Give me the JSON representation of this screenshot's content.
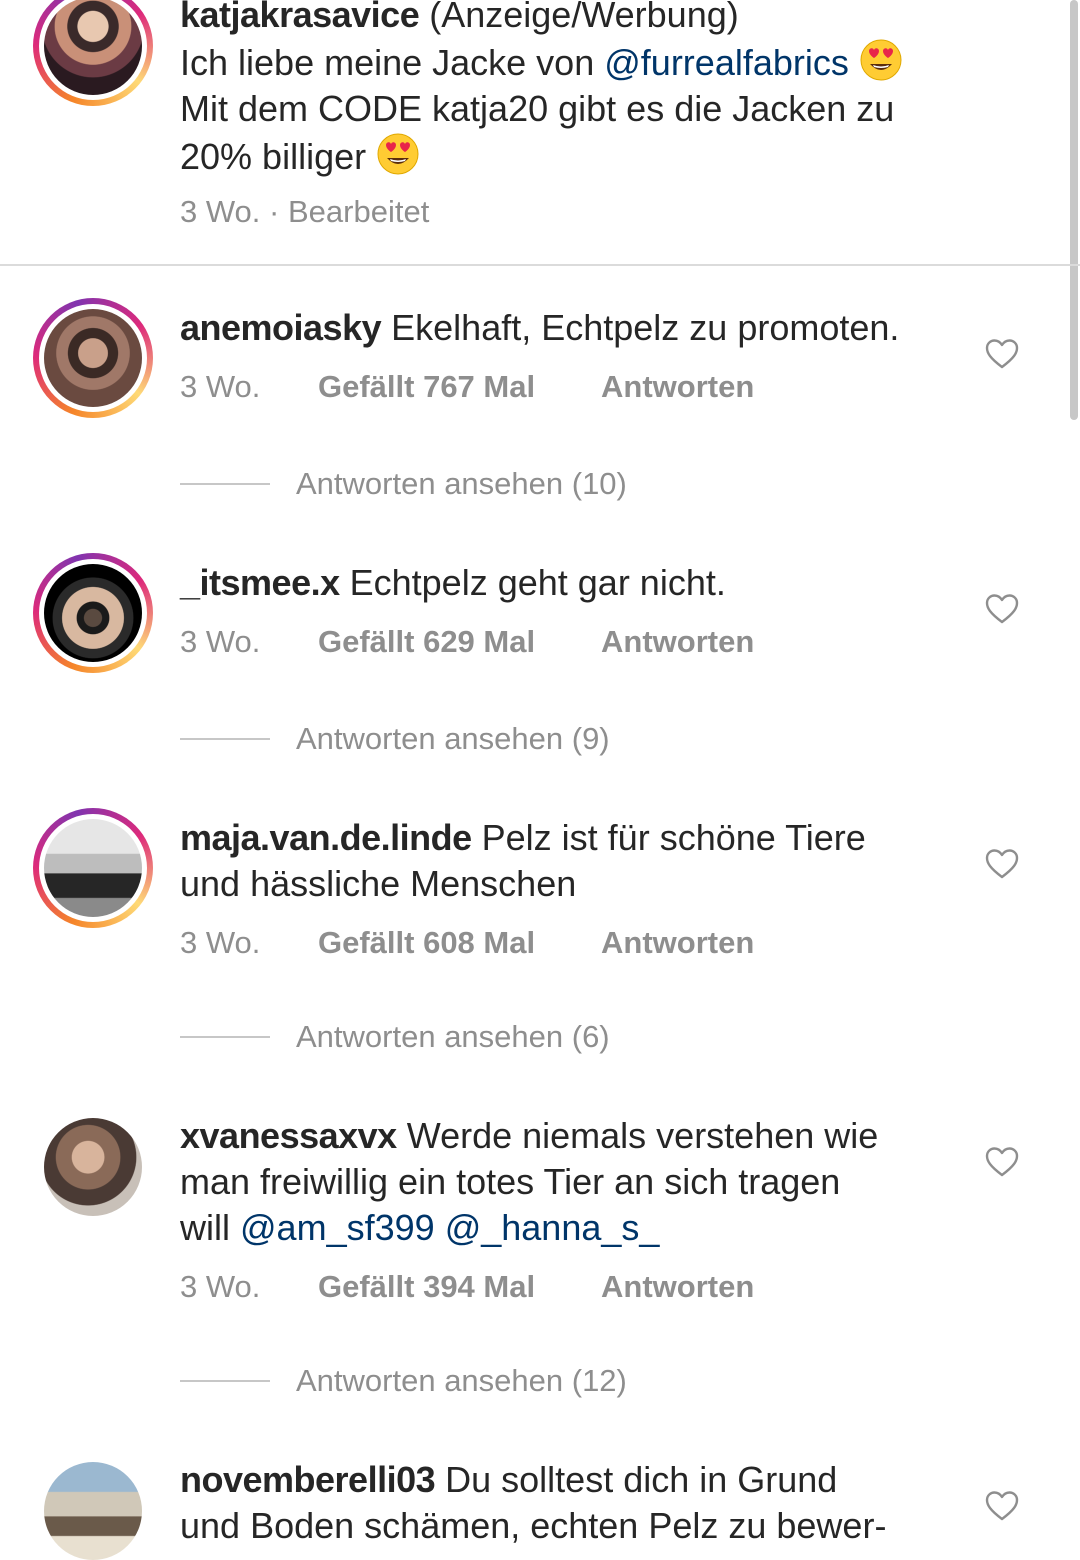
{
  "post": {
    "username": "katjakrasavice",
    "tag": "(Anzeige/Werbung)",
    "line1_text": "Ich liebe meine Jacke von",
    "line1_mention": "@furrealfabrics",
    "line2": "Mit dem CODE katja20 gibt es die Jacken zu",
    "line3": "20% billiger",
    "emoji_name": "smiling-face-with-heart-eyes",
    "time": "3 Wo.",
    "separator": "·",
    "edited": "Bearbeitet"
  },
  "comments": [
    {
      "username": "anemoiasky",
      "text": "Ekelhaft, Echtpelz zu promoten.",
      "time": "3 Wo.",
      "likes": "Gefällt 767 Mal",
      "reply": "Antworten",
      "view_replies": "Antworten ansehen (10)"
    },
    {
      "username": "_itsmee.x",
      "text": "Echtpelz geht gar nicht.",
      "time": "3 Wo.",
      "likes": "Gefällt 629 Mal",
      "reply": "Antworten",
      "view_replies": "Antworten ansehen (9)"
    },
    {
      "username": "maja.van.de.linde",
      "text_line1": "Pelz ist für schöne Tiere",
      "text_line2": "und hässliche Menschen",
      "time": "3 Wo.",
      "likes": "Gefällt 608 Mal",
      "reply": "Antworten",
      "view_replies": "Antworten ansehen (6)"
    },
    {
      "username": "xvanessaxvx",
      "text_line1": "Werde niemals verstehen wie",
      "text_line2": "man freiwillig ein totes Tier an sich tragen",
      "text_line3": "will",
      "mention1": "@am_sf399",
      "mention2": "@_hanna_s_",
      "time": "3 Wo.",
      "likes": "Gefällt 394 Mal",
      "reply": "Antworten",
      "view_replies": "Antworten ansehen (12)"
    },
    {
      "username": "novemberelli03",
      "text_line1": "Du solltest dich in Grund",
      "text_line2": "und Boden schämen, echten Pelz zu bewer-"
    }
  ],
  "icons": {
    "like": "heart-outline-icon"
  },
  "colors": {
    "text": "#262626",
    "secondary": "#8e8e8e",
    "mention": "#003569",
    "ring_start": "#f58529",
    "ring_end": "#dd2a7b"
  }
}
